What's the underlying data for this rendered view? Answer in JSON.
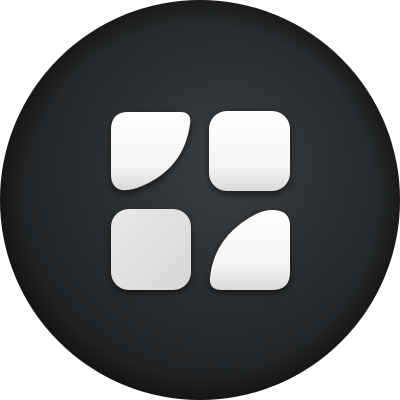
{
  "app_icon": {
    "icon": "app-grid-icon",
    "tiles": [
      {
        "name": "top-left",
        "icon": "leaf-tile-icon"
      },
      {
        "name": "top-right",
        "icon": "rounded-square-tile-icon"
      },
      {
        "name": "bottom-left",
        "icon": "rounded-square-tile-icon"
      },
      {
        "name": "bottom-right",
        "icon": "leaf-tile-icon"
      }
    ]
  },
  "colors": {
    "background_outer": "#ffffff",
    "circle_dark": "#1b1d1f",
    "circle_mid": "#2c2f31",
    "circle_highlight": "#3a3d40",
    "tile_light": "#ffffff",
    "tile_shade": "#d9d9d9"
  }
}
